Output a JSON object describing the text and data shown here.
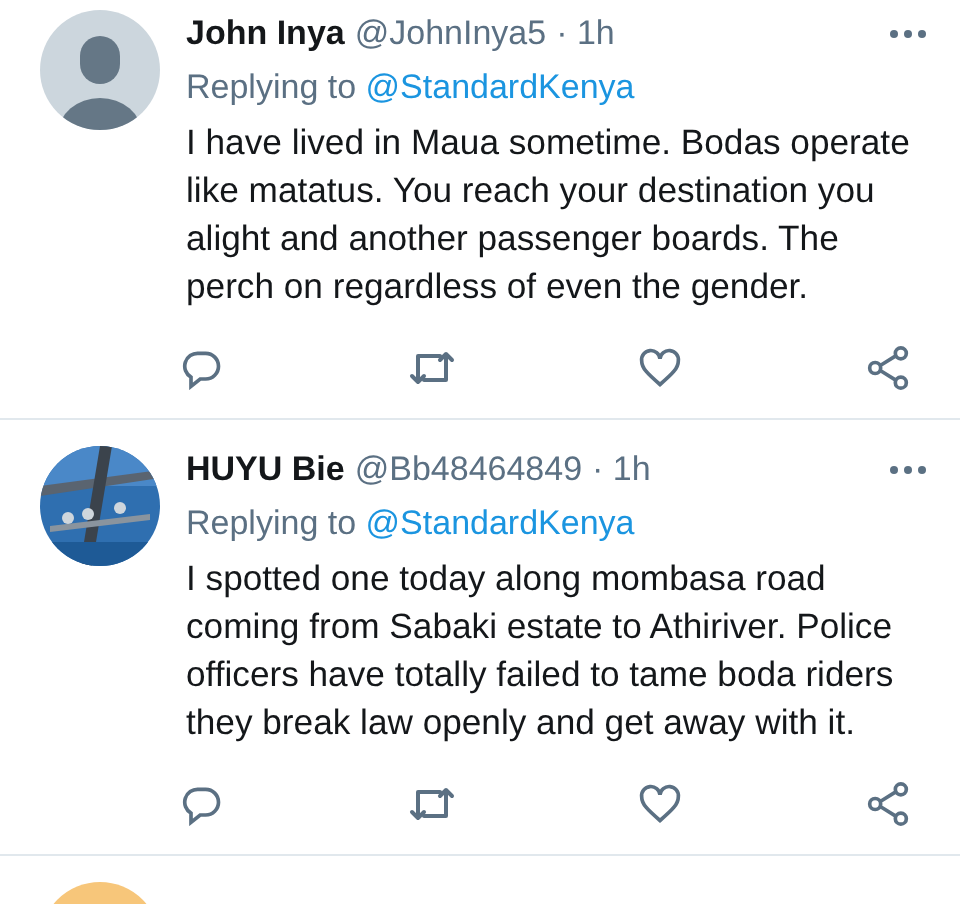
{
  "tweets": [
    {
      "avatar": {
        "kind": "default"
      },
      "name": "John Inya",
      "handle": "@JohnInya5",
      "time": "· 1h",
      "reply_prefix": "Replying to",
      "mention": "@StandardKenya",
      "text": "I have lived in Maua sometime. Bodas operate like matatus. You reach your destination you alight and another passenger boards. The perch on regardless of even the gender."
    },
    {
      "avatar": {
        "kind": "picture"
      },
      "name": "HUYU Bie",
      "handle": "@Bb48464849",
      "time": "· 1h",
      "reply_prefix": "Replying to",
      "mention": "@StandardKenya",
      "text": "I spotted one today along mombasa road coming from Sabaki estate to Athiriver. Police officers have totally failed to tame boda riders they break law openly and get away with it."
    },
    {
      "avatar": {
        "kind": "picture"
      }
    }
  ]
}
